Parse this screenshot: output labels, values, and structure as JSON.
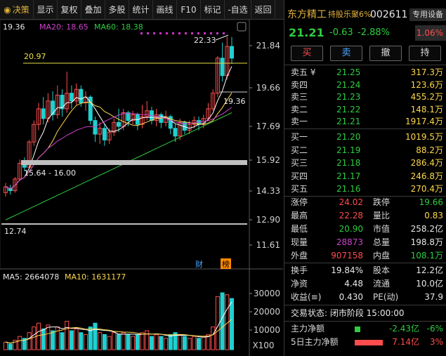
{
  "toolbar": {
    "items": [
      "决策",
      "显示",
      "复权",
      "叠加",
      "多股",
      "统计",
      "画线",
      "F10",
      "标记",
      "-自选",
      "返回"
    ]
  },
  "ma_legend": {
    "ma5": "19.36",
    "ma20": "MA20: 18.65",
    "ma60": "MA60: 18.38"
  },
  "price_axis": [
    "21.84",
    "19.66",
    "17.69",
    "15.92",
    "14.33",
    "12.90",
    "11.61"
  ],
  "annotations": {
    "high_label": "22.33",
    "level_2097": "20.97",
    "level_1936": "19.36",
    "band_label": "15.64 - 16.00",
    "low_label": "12.74",
    "cai_label": "财",
    "bang_label": "榜"
  },
  "volume": {
    "legend_ma5": "MA5: 2664078",
    "legend_ma10": "MA10: 1631177",
    "axis": [
      "30000",
      "20000",
      "10000"
    ],
    "unit": "X100"
  },
  "quote": {
    "name": "东方精工",
    "tag": "持股乐聚6%",
    "code": "002611",
    "special_btn": "专用设备",
    "price": "21.21",
    "change": "-0.63",
    "pct": "-2.88%",
    "ratio": "1.06%",
    "buttons": [
      "买",
      "卖",
      "撤",
      "持"
    ]
  },
  "order_book": {
    "sell": [
      {
        "label": "卖五 ¥",
        "price": "21.25",
        "vol": "317.3万"
      },
      {
        "label": "卖四",
        "price": "21.24",
        "vol": "123.6万"
      },
      {
        "label": "卖三",
        "price": "21.23",
        "vol": "455.2万"
      },
      {
        "label": "卖二",
        "price": "21.22",
        "vol": "148.1万"
      },
      {
        "label": "卖一",
        "price": "21.21",
        "vol": "1917.4万"
      }
    ],
    "buy": [
      {
        "label": "买一",
        "price": "21.20",
        "vol": "1019.5万"
      },
      {
        "label": "买二",
        "price": "21.19",
        "vol": "88.2万"
      },
      {
        "label": "买三",
        "price": "21.18",
        "vol": "286.4万"
      },
      {
        "label": "买四",
        "price": "21.17",
        "vol": "246.8万"
      },
      {
        "label": "买五",
        "price": "21.16",
        "vol": "270.4万"
      }
    ]
  },
  "stats": {
    "zhangting": {
      "label": "涨停",
      "value": "24.02"
    },
    "dieting": {
      "label": "跌停",
      "value": "19.66"
    },
    "zuigao": {
      "label": "最高",
      "value": "22.28"
    },
    "liangbi": {
      "label": "量比",
      "value": "0.83"
    },
    "zuidi": {
      "label": "最低",
      "value": "20.90"
    },
    "shizhi": {
      "label": "市值",
      "value": "258.2亿"
    },
    "xianliang": {
      "label": "现量",
      "value": "28873"
    },
    "zongliang": {
      "label": "总量",
      "value": "198.8万"
    },
    "waipan": {
      "label": "外盘",
      "value": "907158"
    },
    "neipan": {
      "label": "内盘",
      "value": "108.1万"
    },
    "huanshou": {
      "label": "换手",
      "value": "19.84%"
    },
    "guben": {
      "label": "股本",
      "value": "12.2亿"
    },
    "jingzi": {
      "label": "净资",
      "value": "4.48"
    },
    "liutong": {
      "label": "流通",
      "value": "10.0亿"
    },
    "shouyi": {
      "label": "收益(≡)",
      "value": "0.430"
    },
    "pe": {
      "label": "PE(动)",
      "value": "37.9"
    }
  },
  "status": {
    "trade_status": "交易状态: 闭市阶段 15:00:00",
    "main_flow_label": "主力净额",
    "main_flow_value": "-2.43亿",
    "main_flow_pct": "-6%",
    "five_day_label": "5日主力净额",
    "five_day_value": "7.14亿",
    "five_day_pct": "3%"
  },
  "colors": {
    "up": "#ff4d4d",
    "down": "#2ecc40",
    "ma5": "#ffffff",
    "ma10": "#ffd84a",
    "ma20": "#cc44cc",
    "ma60": "#2ecc40",
    "accent": "#e0b23c"
  }
}
